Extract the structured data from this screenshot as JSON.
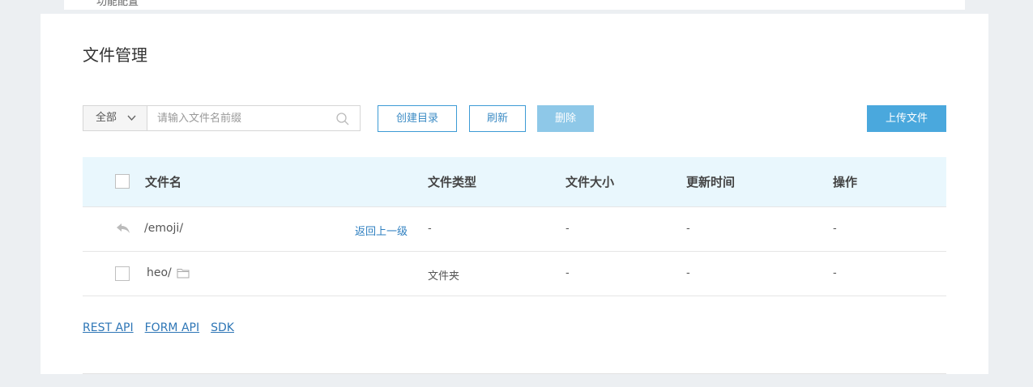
{
  "top_strip": {
    "partial_text": "功能配置"
  },
  "page": {
    "title": "文件管理"
  },
  "toolbar": {
    "scope_selected": "全部",
    "search_placeholder": "请输入文件名前缀",
    "create_dir_label": "创建目录",
    "refresh_label": "刷新",
    "delete_label": "删除",
    "upload_label": "上传文件"
  },
  "table": {
    "headers": {
      "name": "文件名",
      "type": "文件类型",
      "size": "文件大小",
      "updated": "更新时间",
      "actions": "操作"
    },
    "parent_row": {
      "path": "/emoji/",
      "back_label": "返回上一级",
      "type": "-",
      "size": "-",
      "updated": "-",
      "actions": "-"
    },
    "rows": [
      {
        "name": "heo/",
        "type": "文件夹",
        "size": "-",
        "updated": "-",
        "actions": "-"
      }
    ]
  },
  "footer": {
    "links": [
      "REST API",
      "FORM API",
      "SDK"
    ]
  },
  "colors": {
    "accent": "#4aa8dd",
    "header_bg": "#e9f7fd",
    "link": "#2e76b6"
  },
  "icons": {
    "search": "search-icon",
    "back": "reply-arrow-icon",
    "folder": "folder-icon",
    "dropdown": "chevron-down-icon"
  }
}
